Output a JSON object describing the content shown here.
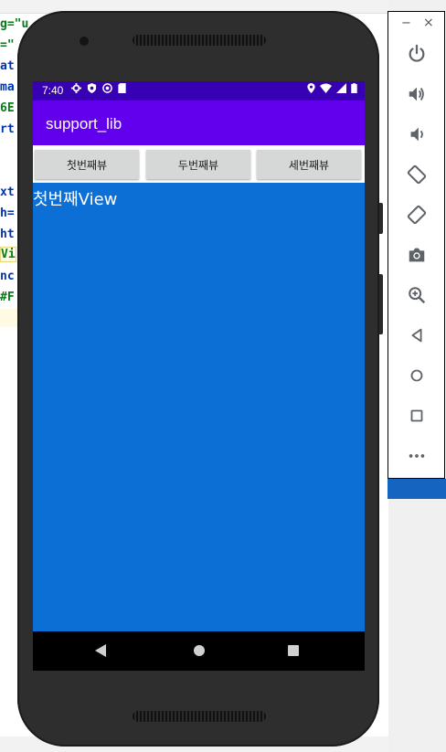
{
  "ide": {
    "code_fragments": [
      "g=\"u",
      "=\"",
      "at",
      "ma",
      "6E",
      "rt",
      "xt",
      "h=",
      "ht",
      "Vi",
      "nc",
      "#F"
    ]
  },
  "device": {
    "status_bar": {
      "time": "7:40"
    },
    "app_bar": {
      "title": "support_lib"
    },
    "buttons": [
      {
        "label": "첫번째뷰"
      },
      {
        "label": "두번째뷰"
      },
      {
        "label": "세번째뷰"
      }
    ],
    "content": {
      "text": "첫번째View",
      "background": "#0b6fd6"
    },
    "colors": {
      "status_bar": "#3700b3",
      "app_bar": "#6200ee"
    }
  },
  "emulator_toolbar": {
    "window_controls": [
      "minimize-icon",
      "close-icon"
    ],
    "items": [
      "power-icon",
      "volume-up-icon",
      "volume-down-icon",
      "rotate-left-icon",
      "rotate-right-icon",
      "camera-icon",
      "zoom-icon",
      "back-icon",
      "home-icon",
      "overview-icon",
      "more-icon"
    ]
  }
}
